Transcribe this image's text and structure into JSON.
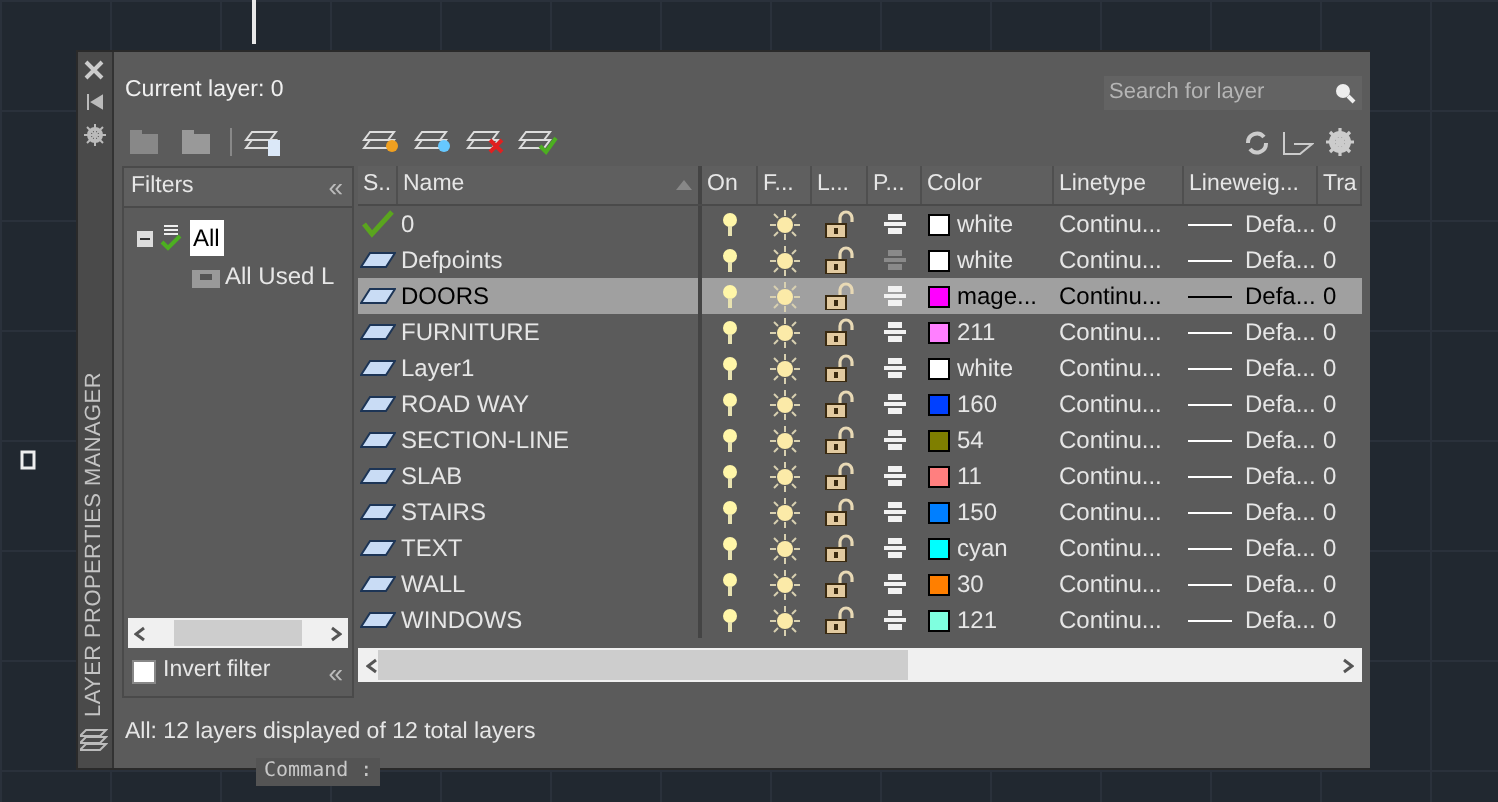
{
  "side_title": "LAYER PROPERTIES MANAGER",
  "current_layer": "Current layer: 0",
  "search": {
    "placeholder": "Search for layer"
  },
  "filters": {
    "title": "Filters",
    "collapse": "«",
    "tree": [
      {
        "label": "All",
        "selected": true,
        "expanded": true,
        "children": [
          {
            "label": "All Used L",
            "selected": false
          }
        ]
      }
    ],
    "invert": {
      "label": "Invert filter",
      "checked": false,
      "collapse": "«"
    }
  },
  "columns": [
    "S..",
    "Name",
    "On",
    "F...",
    "L...",
    "P...",
    "Color",
    "Linetype",
    "Lineweig...",
    "Tra"
  ],
  "rows": [
    {
      "kind": "current",
      "name": "0",
      "selected": false,
      "on": true,
      "frozen": false,
      "locked": false,
      "plot": true,
      "color": "#ffffff",
      "color_name": "white",
      "linetype": "Continu...",
      "lineweight": "Defa...",
      "transparency": "0"
    },
    {
      "kind": "layer",
      "name": "Defpoints",
      "selected": false,
      "on": true,
      "frozen": false,
      "locked": false,
      "plot": false,
      "color": "#ffffff",
      "color_name": "white",
      "linetype": "Continu...",
      "lineweight": "Defa...",
      "transparency": "0"
    },
    {
      "kind": "layer",
      "name": "DOORS",
      "selected": true,
      "on": true,
      "frozen": false,
      "locked": false,
      "plot": true,
      "color": "#ff00ff",
      "color_name": "mage...",
      "linetype": "Continu...",
      "lineweight": "Defa...",
      "transparency": "0"
    },
    {
      "kind": "layer",
      "name": "FURNITURE",
      "selected": false,
      "on": true,
      "frozen": false,
      "locked": false,
      "plot": true,
      "color": "#ff7fff",
      "color_name": "211",
      "linetype": "Continu...",
      "lineweight": "Defa...",
      "transparency": "0"
    },
    {
      "kind": "layer",
      "name": "Layer1",
      "selected": false,
      "on": true,
      "frozen": false,
      "locked": false,
      "plot": true,
      "color": "#ffffff",
      "color_name": "white",
      "linetype": "Continu...",
      "lineweight": "Defa...",
      "transparency": "0"
    },
    {
      "kind": "layer",
      "name": "ROAD WAY",
      "selected": false,
      "on": true,
      "frozen": false,
      "locked": false,
      "plot": true,
      "color": "#0040ff",
      "color_name": "160",
      "linetype": "Continu...",
      "lineweight": "Defa...",
      "transparency": "0"
    },
    {
      "kind": "layer",
      "name": "SECTION-LINE",
      "selected": false,
      "on": true,
      "frozen": false,
      "locked": false,
      "plot": true,
      "color": "#7f7f00",
      "color_name": "54",
      "linetype": "Continu...",
      "lineweight": "Defa...",
      "transparency": "0"
    },
    {
      "kind": "layer",
      "name": "SLAB",
      "selected": false,
      "on": true,
      "frozen": false,
      "locked": false,
      "plot": true,
      "color": "#ff7f7f",
      "color_name": "11",
      "linetype": "Continu...",
      "lineweight": "Defa...",
      "transparency": "0"
    },
    {
      "kind": "layer",
      "name": "STAIRS",
      "selected": false,
      "on": true,
      "frozen": false,
      "locked": false,
      "plot": true,
      "color": "#007fff",
      "color_name": "150",
      "linetype": "Continu...",
      "lineweight": "Defa...",
      "transparency": "0"
    },
    {
      "kind": "layer",
      "name": "TEXT",
      "selected": false,
      "on": true,
      "frozen": false,
      "locked": false,
      "plot": true,
      "color": "#00ffff",
      "color_name": "cyan",
      "linetype": "Continu...",
      "lineweight": "Defa...",
      "transparency": "0"
    },
    {
      "kind": "layer",
      "name": "WALL",
      "selected": false,
      "on": true,
      "frozen": false,
      "locked": false,
      "plot": true,
      "color": "#ff7f00",
      "color_name": "30",
      "linetype": "Continu...",
      "lineweight": "Defa...",
      "transparency": "0"
    },
    {
      "kind": "layer",
      "name": "WINDOWS",
      "selected": false,
      "on": true,
      "frozen": false,
      "locked": false,
      "plot": true,
      "color": "#7fffdf",
      "color_name": "121",
      "linetype": "Continu...",
      "lineweight": "Defa...",
      "transparency": "0"
    }
  ],
  "status": "All: 12 layers displayed of 12 total layers",
  "command": "Command :"
}
